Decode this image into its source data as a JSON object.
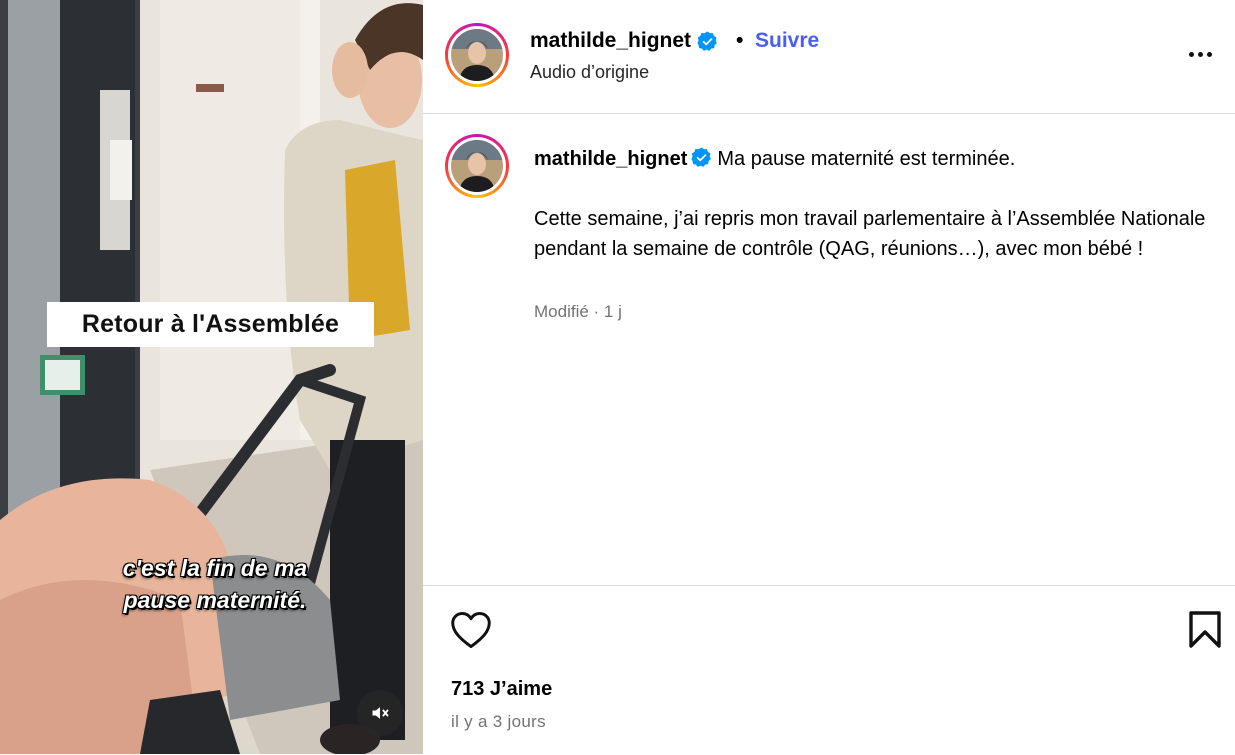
{
  "media": {
    "overlay_title": "Retour à l'Assemblée",
    "subtitle_line1": "c'est la fin de ma",
    "subtitle_line2": "pause maternité.",
    "mute_icon": "speaker-muted-icon"
  },
  "header": {
    "username": "mathilde_hignet",
    "separator": "•",
    "follow_label": "Suivre",
    "audio_label": "Audio d’origine",
    "more_icon": "more-options-icon"
  },
  "caption": {
    "username": "mathilde_hignet",
    "line1": "Ma pause maternité est terminée.",
    "paragraph": "Cette semaine, j’ai repris mon travail parlementaire à l’Assemblée Nationale pendant la semaine de contrôle (QAG, réunions…), avec mon bébé !",
    "meta": "Modifié · 1 j"
  },
  "footer": {
    "likes": "713 J’aime",
    "time": "il y a 3 jours",
    "like_icon": "heart-icon",
    "save_icon": "bookmark-icon"
  },
  "colors": {
    "follow": "#4a5df9",
    "verified": "#0095f6",
    "muted_text": "#737373",
    "divider": "#dbdbdb"
  }
}
